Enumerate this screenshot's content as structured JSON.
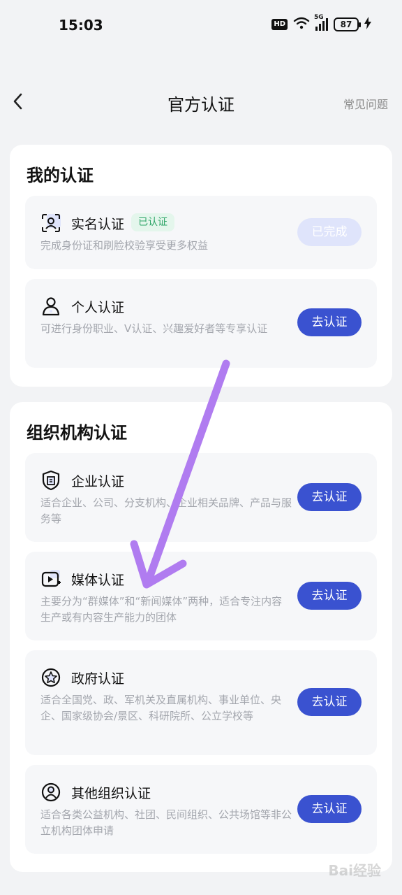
{
  "status_bar": {
    "time": "15:03",
    "hd_label": "HD",
    "network_label": "5G",
    "battery": "87"
  },
  "nav": {
    "title": "官方认证",
    "faq_label": "常见问题"
  },
  "my_section": {
    "title": "我的认证",
    "items": [
      {
        "title": "实名认证",
        "tag": "已认证",
        "desc": "完成身份证和刷脸校验享受更多权益",
        "button": "已完成",
        "icon": "face-scan-icon"
      },
      {
        "title": "个人认证",
        "desc": "可进行身份职业、V认证、兴趣爱好者等专享认证",
        "button": "去认证",
        "icon": "person-icon"
      }
    ]
  },
  "org_section": {
    "title": "组织机构认证",
    "items": [
      {
        "title": "企业认证",
        "desc": "适合企业、公司、分支机构、企业相关品牌、产品与服务等",
        "button": "去认证",
        "icon": "enterprise-shield-icon"
      },
      {
        "title": "媒体认证",
        "desc": "主要分为“群媒体”和“新闻媒体”两种，适合专注内容生产或有内容生产能力的团体",
        "button": "去认证",
        "icon": "media-play-icon"
      },
      {
        "title": "政府认证",
        "desc": "适合全国党、政、军机关及直属机构、事业单位、央企、国家级协会/景区、科研院所、公立学校等",
        "button": "去认证",
        "icon": "government-star-icon"
      },
      {
        "title": "其他组织认证",
        "desc": "适合各类公益机构、社团、民间组织、公共场馆等非公立机构团体申请",
        "button": "去认证",
        "icon": "organization-person-icon"
      }
    ]
  },
  "watermark": "Bai经验",
  "colors": {
    "primary": "#3a52d0",
    "verified_green": "#2ca466",
    "arrow": "#b07cf0"
  }
}
